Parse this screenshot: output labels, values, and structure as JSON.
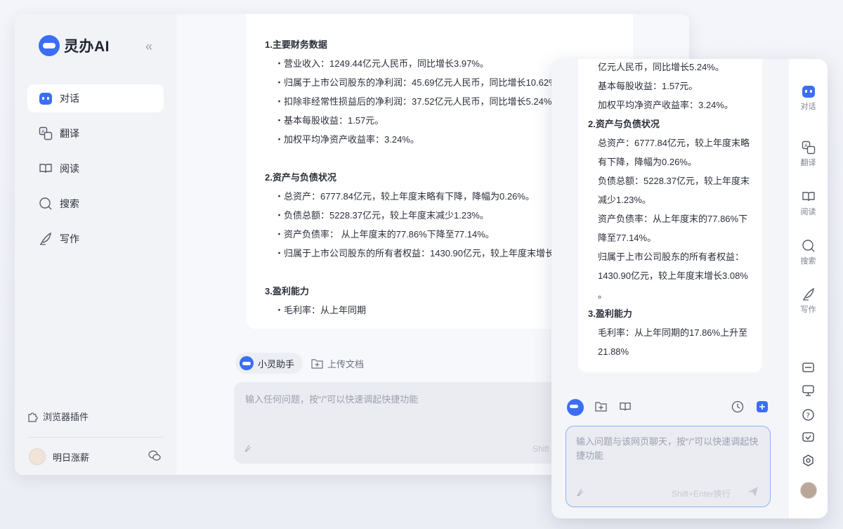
{
  "app": {
    "name": "灵办AI",
    "collapse_glyph": "«"
  },
  "sidebar": {
    "items": [
      {
        "label": "对话",
        "icon": "chat-bot-icon",
        "active": true
      },
      {
        "label": "翻译",
        "icon": "translate-icon"
      },
      {
        "label": "阅读",
        "icon": "book-icon"
      },
      {
        "label": "搜索",
        "icon": "search-icon"
      },
      {
        "label": "写作",
        "icon": "quill-icon"
      }
    ],
    "plugin_label": "浏览器插件",
    "user_name": "明日涨薪"
  },
  "main": {
    "doc_lines": [
      {
        "t": "1.主要财务数据",
        "kind": "h"
      },
      {
        "t": "・营业收入：1249.44亿元人民币，同比增长3.97%。",
        "kind": "li"
      },
      {
        "t": "・归属于上市公司股东的净利润：45.69亿元人民币，同比增长10.62%。",
        "kind": "li"
      },
      {
        "t": "・扣除非经常性损益后的净利润：37.52亿元人民币，同比增长5.24%。",
        "kind": "li"
      },
      {
        "t": "・基本每股收益：1.57元。",
        "kind": "li"
      },
      {
        "t": "・加权平均净资产收益率：3.24%。",
        "kind": "li"
      },
      {
        "t": "",
        "kind": "gap"
      },
      {
        "t": "2.资产与负债状况",
        "kind": "h"
      },
      {
        "t": "・总资产：6777.84亿元，较上年度末略有下降，降幅为0.26%。",
        "kind": "li"
      },
      {
        "t": "・负债总额：5228.37亿元，较上年度末减少1.23%。",
        "kind": "li"
      },
      {
        "t": "・资产负债率： 从上年度末的77.86%下降至77.14%。",
        "kind": "li"
      },
      {
        "t": "・归属于上市公司股东的所有者权益：1430.90亿元，较上年度末增长3.",
        "kind": "li"
      },
      {
        "t": "",
        "kind": "gap"
      },
      {
        "t": "3.盈利能力",
        "kind": "h"
      },
      {
        "t": "・毛利率：从上年同期",
        "kind": "li"
      }
    ],
    "assistant_chip": "小灵助手",
    "upload_label": "上传文档",
    "input_placeholder": "输入任何问题，按“/”可以快速调起快捷功能",
    "input_hint": "Shift"
  },
  "side_panel": {
    "doc_lines": [
      {
        "t": "亿元人民币，同比增长5.24%。",
        "kind": "p"
      },
      {
        "t": "基本每股收益：1.57元。",
        "kind": "p"
      },
      {
        "t": "加权平均净资产收益率：3.24%。",
        "kind": "p"
      },
      {
        "t": "2.资产与负债状况",
        "kind": "h"
      },
      {
        "t": "总资产：6777.84亿元，较上年度末略",
        "kind": "p"
      },
      {
        "t": "有下降，降幅为0.26%。",
        "kind": "p"
      },
      {
        "t": "负债总额：5228.37亿元，较上年度末",
        "kind": "p"
      },
      {
        "t": "减少1.23%。",
        "kind": "p"
      },
      {
        "t": "资产负债率：从上年度末的77.86%下",
        "kind": "p"
      },
      {
        "t": "降至77.14%。",
        "kind": "p"
      },
      {
        "t": "归属于上市公司股东的所有者权益：",
        "kind": "p"
      },
      {
        "t": "1430.90亿元，较上年度末增长3.08%",
        "kind": "p"
      },
      {
        "t": "。",
        "kind": "p"
      },
      {
        "t": "3.盈利能力",
        "kind": "h"
      },
      {
        "t": "毛利率：从上年同期的17.86%上升至",
        "kind": "p"
      },
      {
        "t": "21.88%",
        "kind": "p"
      }
    ],
    "rail": [
      {
        "label": "对话",
        "icon": "chat-bot-icon"
      },
      {
        "label": "翻译",
        "icon": "translate-icon"
      },
      {
        "label": "阅读",
        "icon": "book-icon"
      },
      {
        "label": "搜索",
        "icon": "search-icon"
      },
      {
        "label": "写作",
        "icon": "quill-icon"
      }
    ],
    "input_placeholder": "输入问题与该网页聊天，按“/”可以快速调起快捷功能",
    "input_hint": "Shift+Enter换行"
  },
  "colors": {
    "accent": "#3b6ef5",
    "sidebar_bg": "#f2f3f7",
    "text": "#2b2f3a",
    "muted": "#9aa0b0"
  }
}
